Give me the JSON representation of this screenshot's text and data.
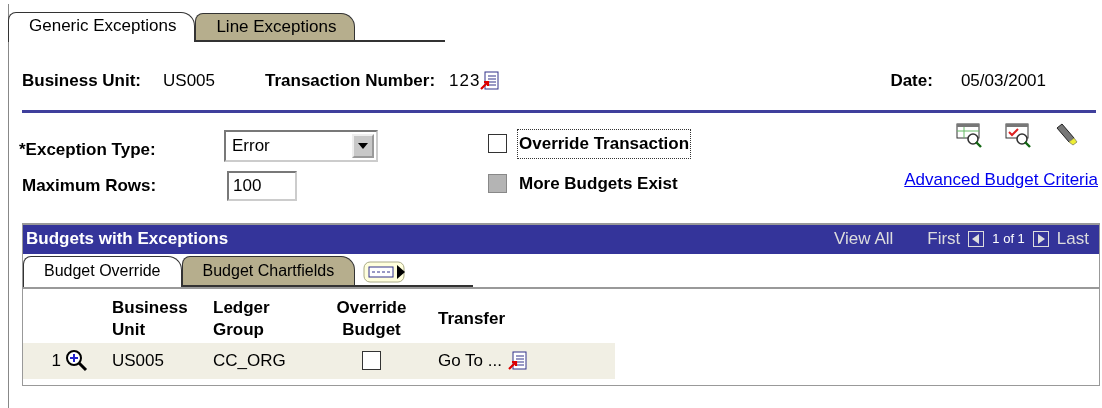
{
  "tabs": [
    {
      "label": "Generic Exceptions",
      "selected": true
    },
    {
      "label": "Line Exceptions",
      "selected": false
    }
  ],
  "header": {
    "business_unit_label": "Business Unit:",
    "business_unit": "US005",
    "transaction_label": "Transaction Number:",
    "transaction": "123",
    "date_label": "Date:",
    "date": "05/03/2001"
  },
  "exception_type": {
    "label": "*Exception Type:",
    "value": "Error"
  },
  "maximum_rows": {
    "label": "Maximum Rows:",
    "value": "100"
  },
  "checkboxes": [
    {
      "label": "Override Transaction",
      "checked": false,
      "disabled": false,
      "focused": true
    },
    {
      "label": "More Budgets Exist",
      "checked": false,
      "disabled": true,
      "focused": false
    }
  ],
  "link": "Advanced Budget Criteria",
  "grid": {
    "title": "Budgets with Exceptions",
    "view_all": "View All",
    "first": "First",
    "page": "1 of 1",
    "last": "Last",
    "tabs": [
      {
        "label": "Budget Override",
        "selected": true
      },
      {
        "label": "Budget Chartfields",
        "selected": false
      }
    ],
    "columns": [
      "Business Unit",
      "Ledger Group",
      "Override Budget",
      "Transfer"
    ],
    "rows": [
      {
        "number": "1",
        "business_unit": "US005",
        "ledger_group": "CC_ORG",
        "override_budget": false,
        "transfer": "Go To ..."
      }
    ]
  }
}
